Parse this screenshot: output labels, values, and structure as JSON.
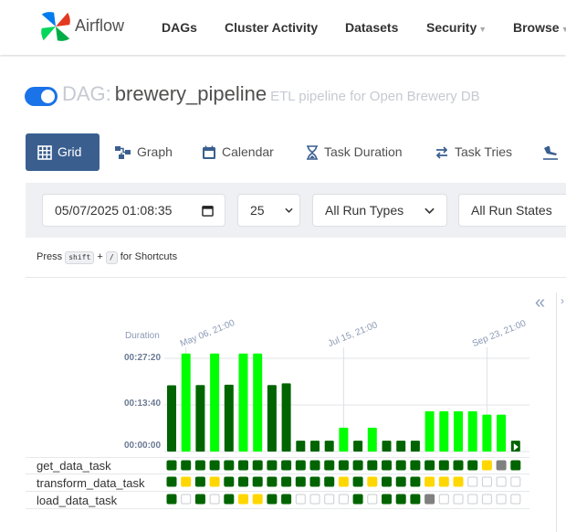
{
  "brand": {
    "name": "Airflow"
  },
  "nav": {
    "dags": "DAGs",
    "cluster_activity": "Cluster Activity",
    "datasets": "Datasets",
    "security": "Security",
    "browse": "Browse"
  },
  "dag": {
    "prefix": "DAG:",
    "name": "brewery_pipeline",
    "description": "ETL pipeline for Open Brewery DB",
    "active": true
  },
  "tabs": {
    "grid": "Grid",
    "graph": "Graph",
    "calendar": "Calendar",
    "task_duration": "Task Duration",
    "task_tries": "Task Tries"
  },
  "filters": {
    "datetime": "05/07/2025 01:08:35",
    "num_runs": "25",
    "run_types": "All Run Types",
    "run_states": "All Run States"
  },
  "shortcuts": {
    "press": "Press",
    "key1": "shift",
    "plus": "+",
    "key2": "/",
    "suffix": "for Shortcuts"
  },
  "grid": {
    "duration_label": "Duration",
    "y_ticks": [
      "00:27:20",
      "00:13:40",
      "00:00:00"
    ],
    "dates": [
      "May 06, 21:00",
      "Jul 15, 21:00",
      "Sep 23, 21:00"
    ],
    "tasks": [
      "get_data_task",
      "transform_data_task",
      "load_data_task"
    ]
  },
  "colors": {
    "success_dark": "#006400",
    "success_light": "#00ff00",
    "upstream_failed": "#ffd700",
    "skipped": "#808080",
    "none": "#ffffff"
  },
  "chart_data": {
    "type": "bar",
    "y_unit": "seconds",
    "ylim": [
      0,
      1640
    ],
    "durations": [
      1165,
      1725,
      1170,
      1725,
      1175,
      1725,
      1725,
      1170,
      1200,
      190,
      190,
      190,
      420,
      190,
      420,
      190,
      190,
      190,
      710,
      710,
      710,
      710,
      650,
      650,
      190
    ],
    "bar_colors": [
      "dark",
      "light",
      "dark",
      "light",
      "dark",
      "light",
      "light",
      "dark",
      "dark",
      "dark",
      "dark",
      "dark",
      "light",
      "dark",
      "light",
      "dark",
      "dark",
      "dark",
      "light",
      "light",
      "light",
      "light",
      "light",
      "light",
      "dark"
    ],
    "task_states": {
      "get_data_task": [
        "dark",
        "dark",
        "dark",
        "dark",
        "dark",
        "dark",
        "dark",
        "dark",
        "dark",
        "dark",
        "dark",
        "dark",
        "dark",
        "dark",
        "dark",
        "dark",
        "dark",
        "dark",
        "dark",
        "dark",
        "dark",
        "dark",
        "yellow",
        "gray",
        "dark"
      ],
      "transform_data_task": [
        "dark",
        "yellow",
        "dark",
        "yellow",
        "dark",
        "dark",
        "dark",
        "dark",
        "dark",
        "dark",
        "dark",
        "dark",
        "yellow",
        "dark",
        "yellow",
        "dark",
        "dark",
        "dark",
        "yellow",
        "yellow",
        "yellow",
        "empty",
        "empty",
        "empty",
        "empty"
      ],
      "load_data_task": [
        "dark",
        "empty",
        "dark",
        "empty",
        "dark",
        "yellow",
        "yellow",
        "dark",
        "dark",
        "empty",
        "empty",
        "empty",
        "empty",
        "dark",
        "empty",
        "dark",
        "dark",
        "dark",
        "gray",
        "empty",
        "empty",
        "empty",
        "empty",
        "empty",
        "empty"
      ]
    }
  }
}
